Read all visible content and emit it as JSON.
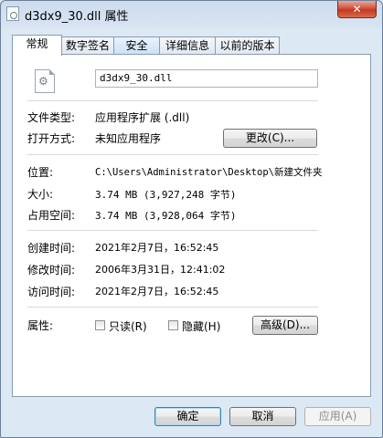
{
  "window": {
    "title": "d3dx9_30.dll 属性",
    "close_label": "✕"
  },
  "tabs": [
    {
      "label": "常规"
    },
    {
      "label": "数字签名"
    },
    {
      "label": "安全"
    },
    {
      "label": "详细信息"
    },
    {
      "label": "以前的版本"
    }
  ],
  "general": {
    "file_name": "d3dx9_30.dll",
    "file_type_label": "文件类型:",
    "file_type_value": "应用程序扩展 (.dll)",
    "open_with_label": "打开方式:",
    "open_with_value": "未知应用程序",
    "change_button": "更改(C)...",
    "location_label": "位置:",
    "location_value": "C:\\Users\\Administrator\\Desktop\\新建文件夹",
    "size_label": "大小:",
    "size_value": "3.74 MB (3,927,248 字节)",
    "size_on_disk_label": "占用空间:",
    "size_on_disk_value": "3.74 MB (3,928,064 字节)",
    "created_label": "创建时间:",
    "created_value": "2021年2月7日，16:52:45",
    "modified_label": "修改时间:",
    "modified_value": "2006年3月31日，12:41:02",
    "accessed_label": "访问时间:",
    "accessed_value": "2021年2月7日，16:52:45",
    "attributes_label": "属性:",
    "readonly_label": "只读(R)",
    "readonly_checked": false,
    "hidden_label": "隐藏(H)",
    "hidden_checked": false,
    "advanced_button": "高级(D)..."
  },
  "footer": {
    "ok_button": "确定",
    "cancel_button": "取消",
    "apply_button": "应用(A)"
  }
}
